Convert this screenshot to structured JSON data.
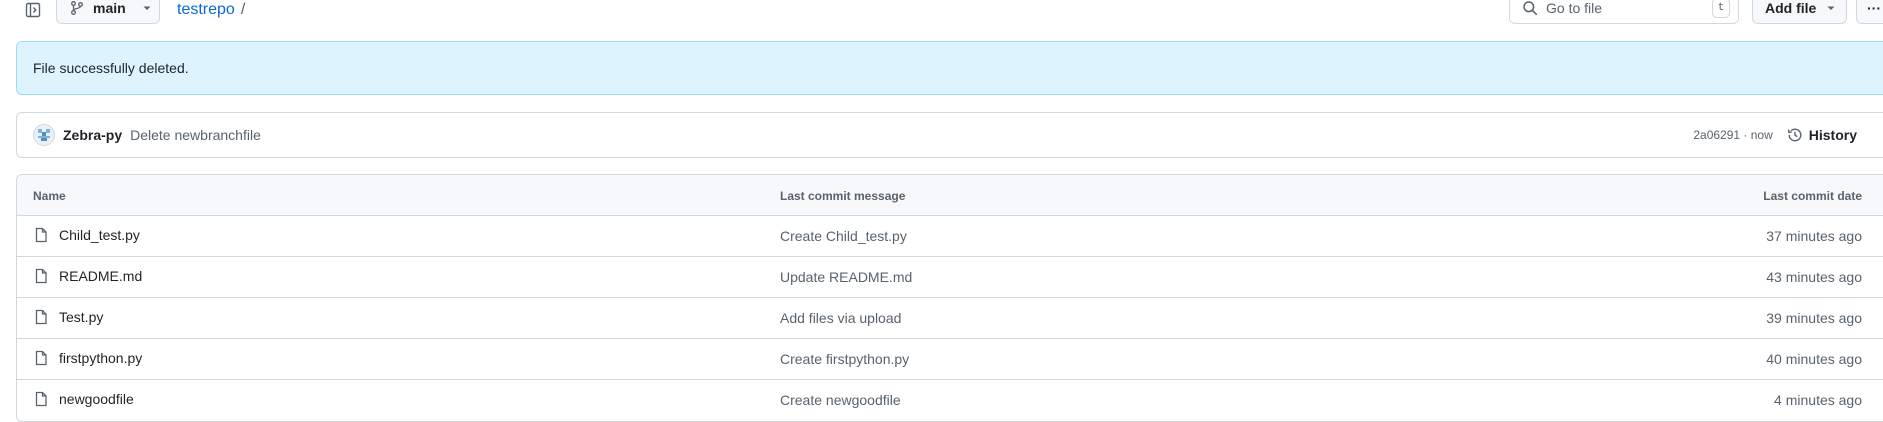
{
  "toolbar": {
    "branch": "main",
    "repo": "testrepo",
    "separator": "/",
    "search_placeholder": "Go to file",
    "search_shortcut": "t",
    "add_file_label": "Add file",
    "more_label": "···"
  },
  "flash": {
    "message": "File successfully deleted."
  },
  "commit": {
    "author": "Zebra-py",
    "message": "Delete newbranchfile",
    "sha_time": "2a06291 · now",
    "history_label": "History"
  },
  "table": {
    "headers": {
      "name": "Name",
      "message": "Last commit message",
      "date": "Last commit date"
    },
    "rows": [
      {
        "name": "Child_test.py",
        "message": "Create Child_test.py",
        "date": "37 minutes ago"
      },
      {
        "name": "README.md",
        "message": "Update README.md",
        "date": "43 minutes ago"
      },
      {
        "name": "Test.py",
        "message": "Add files via upload",
        "date": "39 minutes ago"
      },
      {
        "name": "firstpython.py",
        "message": "Create firstpython.py",
        "date": "40 minutes ago"
      },
      {
        "name": "newgoodfile",
        "message": "Create newgoodfile",
        "date": "4 minutes ago"
      }
    ]
  },
  "icons": {
    "sidebar": "sidebar-expand-icon",
    "branch": "git-branch-icon",
    "search": "search-icon",
    "file": "file-icon",
    "history": "history-clock-icon"
  },
  "colors": {
    "link": "#0969da",
    "flash_bg": "#ddf4ff",
    "border": "#d1d9e0",
    "muted": "#59636e"
  }
}
